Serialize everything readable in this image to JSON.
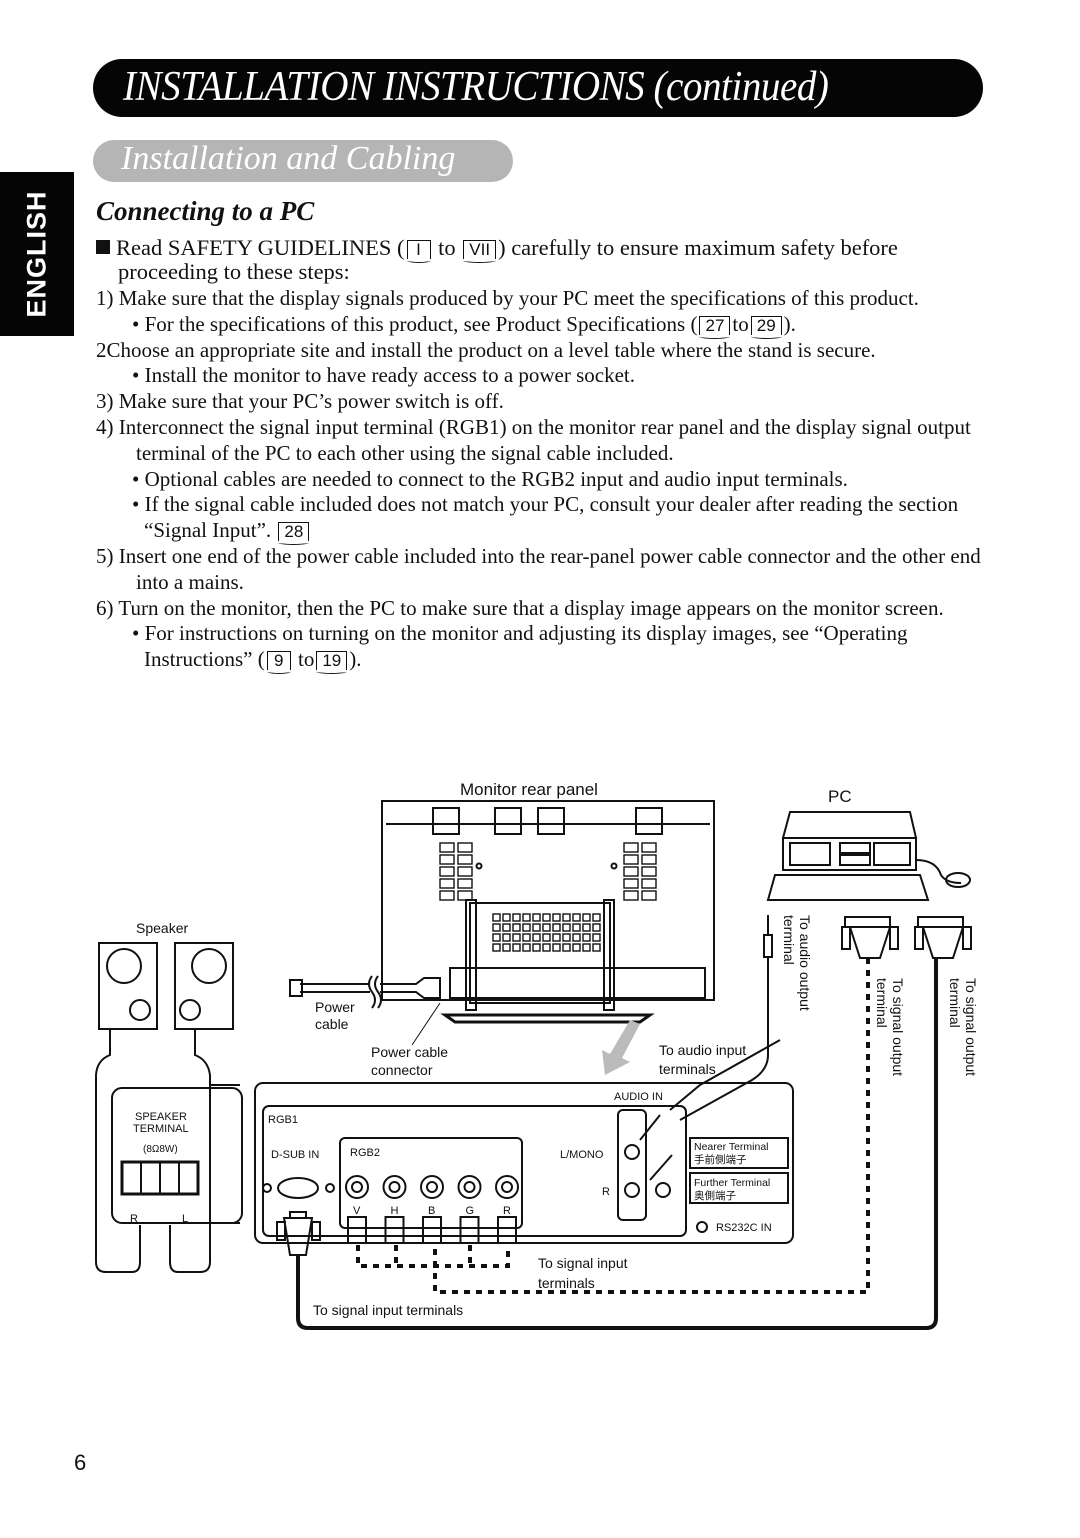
{
  "header": {
    "title": "INSTALLATION INSTRUCTIONS (continued)",
    "subtitle": "Installation and Cabling",
    "language_tab": "ENGLISH"
  },
  "section": {
    "heading": "Connecting to a PC",
    "lead": {
      "pre": "Read SAFETY GUIDELINES (",
      "ref_from": "I",
      "to": "to",
      "ref_to": "VII",
      "post": ") carefully to ensure maximum safety before proceeding to these steps:"
    },
    "step1": "1) Make sure that the display signals produced by your PC meet the specifications of this product.",
    "step1_bullet": {
      "pre": "• For the specifications of this product, see Product Specifications (",
      "ref_from": "27",
      "to": "to",
      "ref_to": "29",
      "post": ")."
    },
    "step2": "2Choose an appropriate site and install the product on a level table where the stand is secure.",
    "step2_bullet": "• Install the monitor to have ready access to a power socket.",
    "step3": "3) Make sure that your PC’s power switch is off.",
    "step4": "4) Interconnect the signal input terminal (RGB1) on the monitor rear panel and the display signal output terminal of the PC to each other using the signal cable included.",
    "step4_bullet1": "• Optional cables are needed to connect to the RGB2 input and audio input terminals.",
    "step4_bullet2": {
      "pre": "• If the signal cable included does not match your PC, consult your dealer after reading the section “Signal Input”.",
      "ref": "28"
    },
    "step5": "5) Insert one end of the power cable included into the rear-panel power cable connector and the other end into a mains.",
    "step6": "6) Turn on the monitor, then the PC to make sure that a display image appears on the monitor screen.",
    "step6_bullet": {
      "pre": "• For instructions on turning on the monitor and adjusting its display images, see “Operating Instructions” (",
      "ref_from": "9",
      "to": "to",
      "ref_to": "19",
      "post": ")."
    }
  },
  "diagram": {
    "monitor_label": "Monitor rear panel",
    "pc_label": "PC",
    "speaker_label": "Speaker",
    "power_cable": [
      "Power",
      "cable"
    ],
    "power_cable_connector": [
      "Power cable",
      "connector"
    ],
    "audio_input": [
      "To audio input",
      "terminals"
    ],
    "audio_output": [
      "To audio output",
      "terminal"
    ],
    "signal_output_1": [
      "To signal output",
      "terminal"
    ],
    "signal_output_2": [
      "To signal output",
      "terminal"
    ],
    "speaker_terminal": [
      "SPEAKER",
      "TERMINAL",
      "(8Ω8W)"
    ],
    "speaker_r": "R",
    "speaker_l": "L",
    "rgb1": "RGB1",
    "dsub_in": "D-SUB  IN",
    "rgb2": "RGB2",
    "bnc_labels": [
      "V",
      "H",
      "B",
      "G",
      "R"
    ],
    "audio_in": "AUDIO  IN",
    "l_mono": "L/MONO",
    "audio_r": "R",
    "nearer_terminal": [
      "Nearer Terminal",
      "手前側端子"
    ],
    "further_terminal": [
      "Further Terminal",
      "奥側端子"
    ],
    "rs232c": "RS232C  IN",
    "signal_input_terminals_1": [
      "To signal input",
      "terminals"
    ],
    "signal_input_terminals_2": "To signal input terminals"
  },
  "footer": {
    "page_number": "6"
  }
}
